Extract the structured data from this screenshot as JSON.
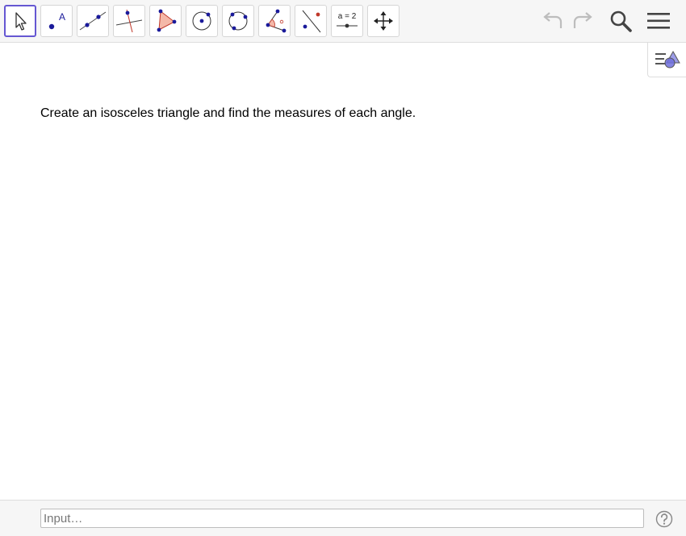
{
  "toolbar": {
    "tools": [
      {
        "name": "Move",
        "icon": "move-arrow-icon"
      },
      {
        "name": "Point",
        "icon": "point-icon",
        "glyph": "A"
      },
      {
        "name": "Line",
        "icon": "line-through-points-icon"
      },
      {
        "name": "Perpendicular Line",
        "icon": "perpendicular-line-icon"
      },
      {
        "name": "Polygon",
        "icon": "polygon-icon"
      },
      {
        "name": "Circle with Center through Point",
        "icon": "circle-center-point-icon"
      },
      {
        "name": "Circle through 3 Points",
        "icon": "circle-three-points-icon"
      },
      {
        "name": "Angle",
        "icon": "angle-icon"
      },
      {
        "name": "Reflect about Line",
        "icon": "reflect-line-icon"
      },
      {
        "name": "Slider",
        "icon": "slider-icon",
        "glyph": "a = 2"
      },
      {
        "name": "Move Graphics View",
        "icon": "move-graphics-view-icon"
      }
    ],
    "selected_tool": "Move"
  },
  "task": {
    "text": "Create an isosceles triangle and find the measures of each angle."
  },
  "input_bar": {
    "placeholder": "Input…",
    "value": ""
  },
  "colors": {
    "accent": "#6557d2",
    "point": "#1a1a9a",
    "polygon_fill": "#f4b8a8",
    "line_red": "#c0392b",
    "icon_gray": "#555555"
  }
}
